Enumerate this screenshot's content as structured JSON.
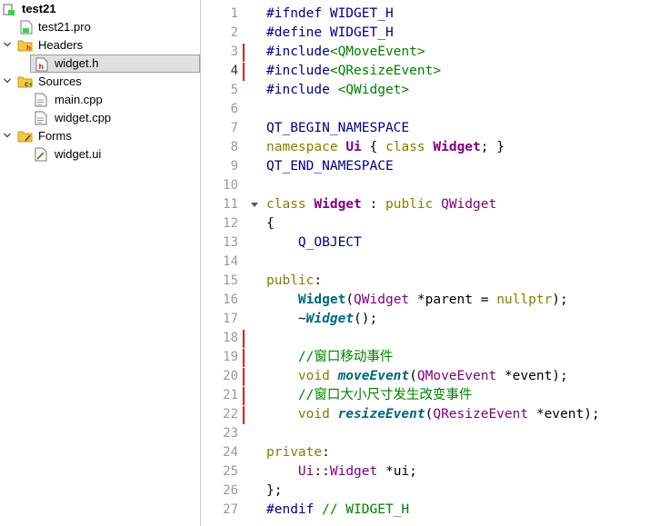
{
  "tree": {
    "project": "test21",
    "pro_file": "test21.pro",
    "headers_label": "Headers",
    "header_file": "widget.h",
    "sources_label": "Sources",
    "source_files": [
      "main.cpp",
      "widget.cpp"
    ],
    "forms_label": "Forms",
    "form_file": "widget.ui"
  },
  "editor": {
    "current_line": 4,
    "changed_lines": [
      3,
      4,
      18,
      19,
      20,
      21,
      22
    ],
    "fold_lines": [
      11
    ],
    "lines": [
      [
        [
          "#ifndef WIDGET_H",
          "pp"
        ]
      ],
      [
        [
          "#define WIDGET_H",
          "pp"
        ]
      ],
      [
        [
          "#include",
          "pp"
        ],
        [
          "<QMoveEvent>",
          "str"
        ]
      ],
      [
        [
          "#include",
          "pp"
        ],
        [
          "<QResizeEvent>",
          "str"
        ]
      ],
      [
        [
          "#include ",
          "pp"
        ],
        [
          "<QWidget>",
          "str"
        ]
      ],
      [],
      [
        [
          "QT_BEGIN_NAMESPACE",
          "mac"
        ]
      ],
      [
        [
          "namespace ",
          "kw"
        ],
        [
          "Ui",
          "ty b"
        ],
        [
          " { ",
          ""
        ],
        [
          "class ",
          "kw"
        ],
        [
          "Widget",
          "ty b"
        ],
        [
          "; }",
          ""
        ]
      ],
      [
        [
          "QT_END_NAMESPACE",
          "mac"
        ]
      ],
      [],
      [
        [
          "class ",
          "kw"
        ],
        [
          "Widget",
          "ty b"
        ],
        [
          " : ",
          ""
        ],
        [
          "public ",
          "kw"
        ],
        [
          "QWidget",
          "ty"
        ]
      ],
      [
        [
          "{",
          ""
        ]
      ],
      [
        [
          "    ",
          ""
        ],
        [
          "Q_OBJECT",
          "mac"
        ]
      ],
      [],
      [
        [
          "public",
          "kw"
        ],
        [
          ":",
          ""
        ]
      ],
      [
        [
          "    ",
          ""
        ],
        [
          "Widget",
          "fn"
        ],
        [
          "(",
          ""
        ],
        [
          "QWidget",
          "ty"
        ],
        [
          " *parent = ",
          ""
        ],
        [
          "nullptr",
          "kw"
        ],
        [
          ");",
          ""
        ]
      ],
      [
        [
          "    ~",
          ""
        ],
        [
          "Widget",
          "fi"
        ],
        [
          "();",
          ""
        ]
      ],
      [],
      [
        [
          "    ",
          ""
        ],
        [
          "//窗口移动事件",
          "cm"
        ]
      ],
      [
        [
          "    ",
          ""
        ],
        [
          "void ",
          "kw"
        ],
        [
          "moveEvent",
          "fi"
        ],
        [
          "(",
          ""
        ],
        [
          "QMoveEvent",
          "ty"
        ],
        [
          " *event);",
          ""
        ]
      ],
      [
        [
          "    ",
          ""
        ],
        [
          "//窗口大小尺寸发生改变事件",
          "cm"
        ]
      ],
      [
        [
          "    ",
          ""
        ],
        [
          "void ",
          "kw"
        ],
        [
          "resizeEvent",
          "fi"
        ],
        [
          "(",
          ""
        ],
        [
          "QResizeEvent",
          "ty"
        ],
        [
          " *event);",
          ""
        ]
      ],
      [],
      [
        [
          "private",
          "kw"
        ],
        [
          ":",
          ""
        ]
      ],
      [
        [
          "    ",
          ""
        ],
        [
          "Ui",
          "ty"
        ],
        [
          "::",
          ""
        ],
        [
          "Widget",
          "ty"
        ],
        [
          " *ui;",
          ""
        ]
      ],
      [
        [
          "};",
          ""
        ]
      ],
      [
        [
          "#endif ",
          "pp"
        ],
        [
          "// WIDGET_H",
          "cm"
        ]
      ]
    ]
  }
}
